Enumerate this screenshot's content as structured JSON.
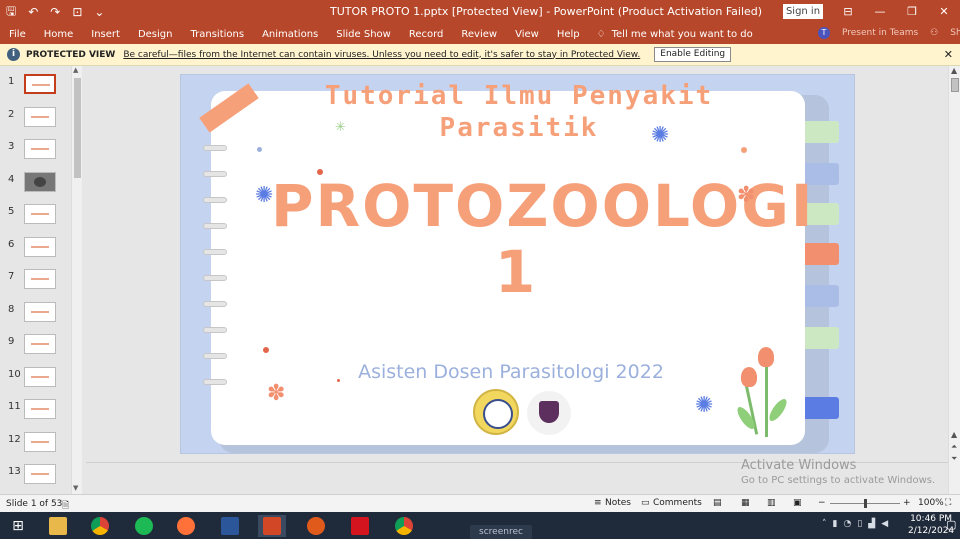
{
  "titlebar": {
    "title": "TUTOR PROTO 1.pptx [Protected View] - PowerPoint (Product Activation Failed)",
    "signin": "Sign in",
    "qat_icons": [
      "save-icon",
      "undo-icon",
      "redo-icon",
      "presenter-icon",
      "customize-icon"
    ]
  },
  "ribbon": {
    "tabs": [
      "File",
      "Home",
      "Insert",
      "Design",
      "Transitions",
      "Animations",
      "Slide Show",
      "Record",
      "Review",
      "View",
      "Help"
    ],
    "tell_me": "Tell me what you want to do",
    "present_in_teams": "Present in Teams",
    "share": "Share"
  },
  "protected_view": {
    "label": "PROTECTED VIEW",
    "message": "Be careful—files from the Internet can contain viruses. Unless you need to edit, it's safer to stay in Protected View.",
    "button": "Enable Editing"
  },
  "thumbnails": [
    "1",
    "2",
    "3",
    "4",
    "5",
    "6",
    "7",
    "8",
    "9",
    "10",
    "11",
    "12",
    "13"
  ],
  "slide": {
    "subtitle_line1": "Tutorial Ilmu Penyakit",
    "subtitle_line2": "Parasitik",
    "title_line1": "PROTOZOOLOGI",
    "title_line2": "1",
    "author": "Asisten Dosen Parasitologi 2022"
  },
  "watermark": {
    "line1": "Activate Windows",
    "line2": "Go to PC settings to activate Windows."
  },
  "statusbar": {
    "slide_info": "Slide 1 of 53",
    "notes": "Notes",
    "comments": "Comments",
    "zoom": "100%"
  },
  "taskbar": {
    "screenrec": "screenrec",
    "time": "10:46 PM",
    "date": "2/12/2024"
  },
  "colors": {
    "accent": "#b7472a",
    "slide_peach": "#f6a07a",
    "slide_blue": "#9bb0dc"
  }
}
